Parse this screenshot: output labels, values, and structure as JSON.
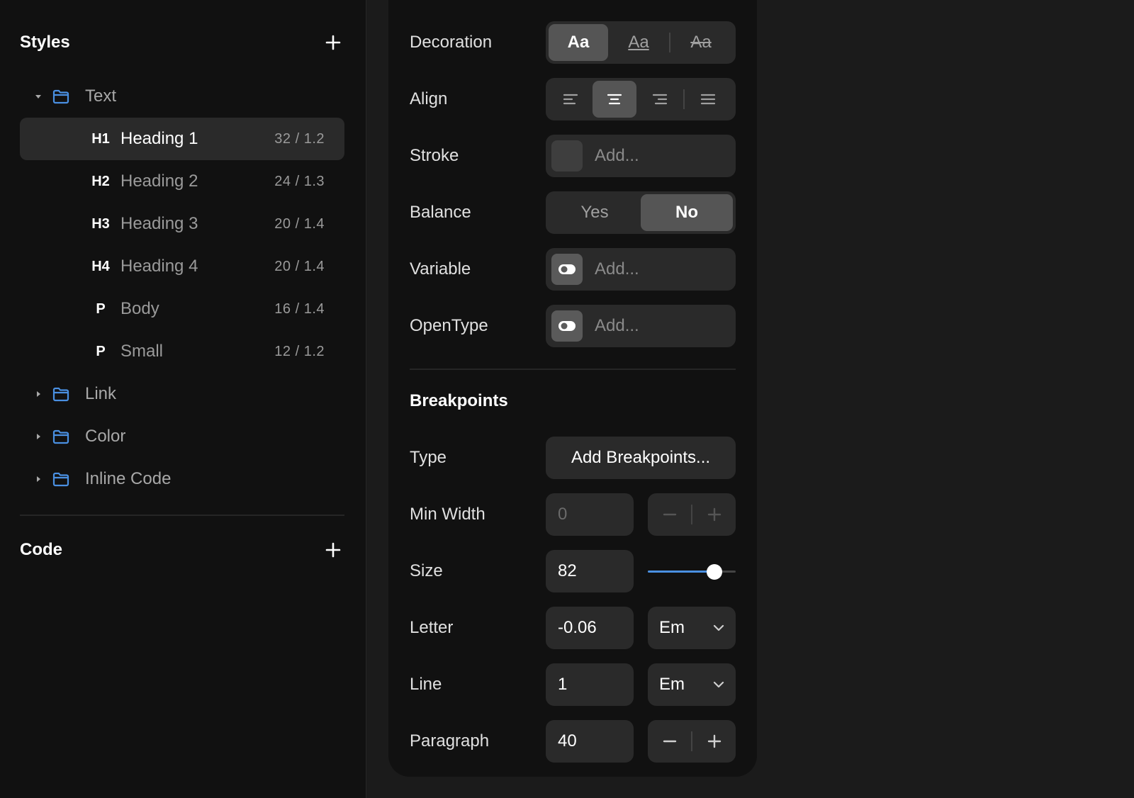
{
  "sidebar": {
    "styles_title": "Styles",
    "code_title": "Code",
    "groups": [
      {
        "label": "Text",
        "expanded": true
      },
      {
        "label": "Link",
        "expanded": false
      },
      {
        "label": "Color",
        "expanded": false
      },
      {
        "label": "Inline Code",
        "expanded": false
      }
    ],
    "text_styles": [
      {
        "tag": "H1",
        "label": "Heading 1",
        "meta": "32 / 1.2",
        "selected": true
      },
      {
        "tag": "H2",
        "label": "Heading 2",
        "meta": "24 / 1.3"
      },
      {
        "tag": "H3",
        "label": "Heading 3",
        "meta": "20 / 1.4"
      },
      {
        "tag": "H4",
        "label": "Heading 4",
        "meta": "20 / 1.4"
      },
      {
        "tag": "P",
        "label": "Body",
        "meta": "16 / 1.4"
      },
      {
        "tag": "P",
        "label": "Small",
        "meta": "12 / 1.2"
      }
    ]
  },
  "panel": {
    "decoration": {
      "label": "Decoration",
      "options": [
        "Aa",
        "Aa",
        "Aa"
      ],
      "selected": 0
    },
    "align": {
      "label": "Align",
      "selected": 1
    },
    "stroke": {
      "label": "Stroke",
      "placeholder": "Add..."
    },
    "balance": {
      "label": "Balance",
      "yes": "Yes",
      "no": "No",
      "selected": "No"
    },
    "variable": {
      "label": "Variable",
      "placeholder": "Add..."
    },
    "opentype": {
      "label": "OpenType",
      "placeholder": "Add..."
    },
    "breakpoints": {
      "title": "Breakpoints",
      "type": {
        "label": "Type",
        "button": "Add Breakpoints..."
      },
      "min_width": {
        "label": "Min Width",
        "value": "0"
      },
      "size": {
        "label": "Size",
        "value": "82",
        "slider_fraction": 0.76
      },
      "letter": {
        "label": "Letter",
        "value": "-0.06",
        "unit": "Em"
      },
      "line": {
        "label": "Line",
        "value": "1",
        "unit": "Em"
      },
      "paragraph": {
        "label": "Paragraph",
        "value": "40"
      }
    }
  },
  "colors": {
    "accent": "#4a90e2",
    "folder": "#4a90e2"
  }
}
